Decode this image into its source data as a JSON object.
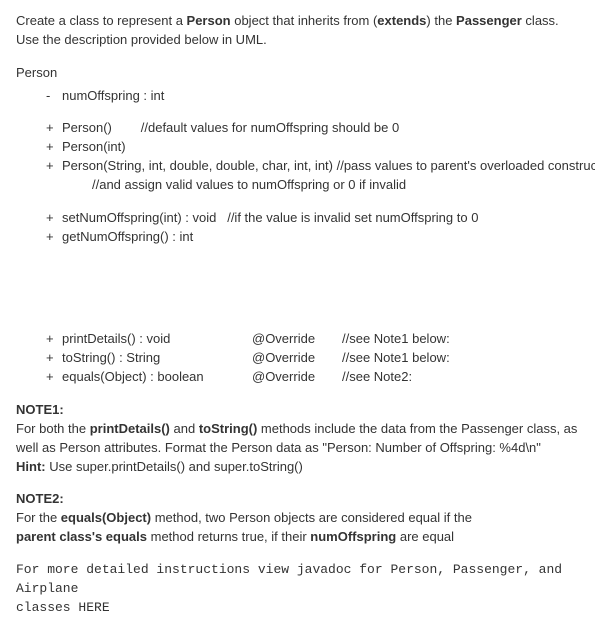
{
  "intro": {
    "part1": "Create a class to represent a ",
    "bold1": "Person",
    "part2": " object that inherits from (",
    "bold2": "extends",
    "part3": ") the ",
    "bold3": "Passenger",
    "part4": " class.",
    "line2": "Use the description provided below in UML."
  },
  "className": "Person",
  "field": {
    "bullet": "-",
    "sig": "numOffspring : int"
  },
  "ctors": [
    {
      "bullet": "+",
      "sig": "Person()",
      "comment": "        //default values for numOffspring should be 0"
    },
    {
      "bullet": "+",
      "sig": "Person(int)",
      "comment": ""
    },
    {
      "bullet": "+",
      "sig": "Person(String, int, double, double, char, int, int) //pass values to parent's overloaded constructor",
      "comment": ""
    }
  ],
  "ctorCont": "//and assign valid values to numOffspring or 0 if invalid",
  "accessors": [
    {
      "bullet": "+",
      "sig": "setNumOffspring(int) : void",
      "comment": "   //if the value is invalid set numOffspring to 0"
    },
    {
      "bullet": "+",
      "sig": "getNumOffspring() : int",
      "comment": ""
    }
  ],
  "overrides": [
    {
      "bullet": "+",
      "sig": "printDetails() : void",
      "ovr": "@Override",
      "note": "//see Note1 below:"
    },
    {
      "bullet": "+",
      "sig": "toString() : String",
      "ovr": "@Override",
      "note": "//see Note1 below:"
    },
    {
      "bullet": "+",
      "sig": "equals(Object) : boolean",
      "ovr": "@Override",
      "note": "//see Note2:"
    }
  ],
  "note1": {
    "head": "NOTE1:",
    "body_a": "For both the ",
    "body_b1": "printDetails()",
    "body_mid": " and ",
    "body_b2": "toString()",
    "body_c": " methods include the data from the Passenger class, as well as Person attributes.  Format the Person data as \"Person: Number of Offspring: %4d\\n\"",
    "hint_b": "Hint:",
    "hint_t": " Use super.printDetails() and super.toString()"
  },
  "note2": {
    "head": "NOTE2:",
    "l1a": "For the ",
    "l1b": "equals(Object)",
    "l1c": " method, two Person objects are considered equal if the",
    "l2a": "parent class's equals",
    "l2b": " method returns true, if their ",
    "l2c": "numOffspring",
    "l2d": " are equal"
  },
  "footer": {
    "l1": "For more detailed instructions view javadoc for Person, Passenger, and Airplane",
    "l2a": "classes ",
    "l2b": "HERE"
  }
}
